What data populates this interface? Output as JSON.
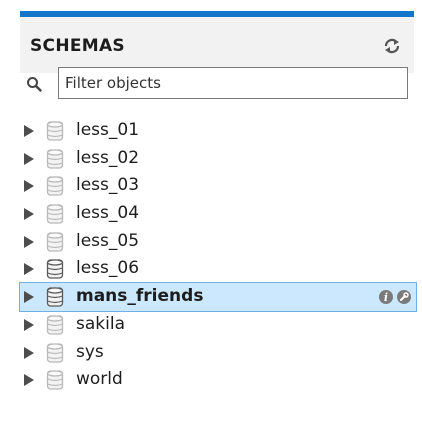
{
  "panel": {
    "title": "SCHEMAS",
    "refresh_icon": "refresh-icon",
    "accent_color": "#1474c9"
  },
  "filter": {
    "placeholder": "Filter objects",
    "value": "",
    "icon": "search-icon"
  },
  "schemas": [
    {
      "label": "less_01",
      "selected": false
    },
    {
      "label": "less_02",
      "selected": false
    },
    {
      "label": "less_03",
      "selected": false
    },
    {
      "label": "less_04",
      "selected": false
    },
    {
      "label": "less_05",
      "selected": false
    },
    {
      "label": "less_06",
      "selected": false
    },
    {
      "label": "mans_friends",
      "selected": true,
      "action_icons": [
        "info-icon",
        "wrench-icon"
      ]
    },
    {
      "label": "sakila",
      "selected": false
    },
    {
      "label": "sys",
      "selected": false
    },
    {
      "label": "world",
      "selected": false
    }
  ]
}
